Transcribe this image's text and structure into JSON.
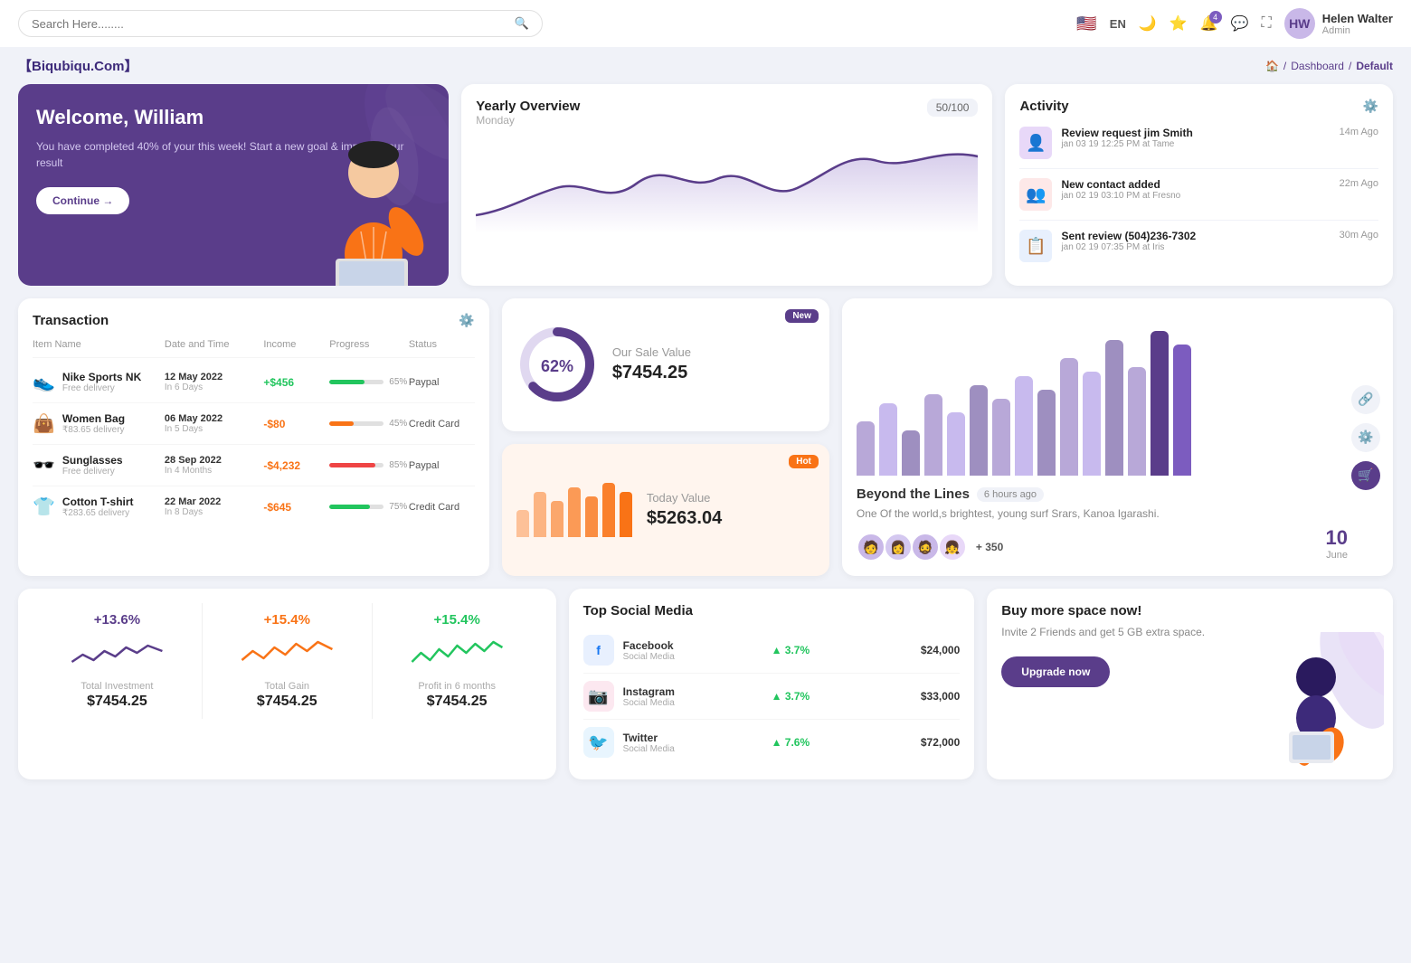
{
  "app": {
    "brand": "【Biqubiqu.Com】",
    "breadcrumb": [
      "Home",
      "Dashboard",
      "Default"
    ]
  },
  "topnav": {
    "search_placeholder": "Search Here........",
    "lang": "EN",
    "notification_count": "4",
    "user": {
      "name": "Helen Walter",
      "role": "Admin",
      "initials": "HW"
    }
  },
  "welcome": {
    "title": "Welcome, William",
    "desc": "You have completed 40% of your this week! Start a new goal & improve your result",
    "button": "Continue →"
  },
  "yearly": {
    "title": "Yearly Overview",
    "sub": "Monday",
    "badge": "50/100"
  },
  "activity": {
    "title": "Activity",
    "items": [
      {
        "title": "Review request jim Smith",
        "time": "jan 03 19 12:25 PM at Tame",
        "ago": "14m Ago",
        "emoji": "🖼️"
      },
      {
        "title": "New contact added",
        "time": "jan 02 19 03:10 PM at Fresno",
        "ago": "22m Ago",
        "emoji": "🖼️"
      },
      {
        "title": "Sent review (504)236-7302",
        "time": "jan 02 19 07:35 PM at Iris",
        "ago": "30m Ago",
        "emoji": "🖼️"
      }
    ]
  },
  "transaction": {
    "title": "Transaction",
    "columns": [
      "Item Name",
      "Date and Time",
      "Income",
      "Progress",
      "Status"
    ],
    "rows": [
      {
        "name": "Nike Sports NK",
        "sub": "Free delivery",
        "date": "12 May 2022",
        "datesub": "In 6 Days",
        "income": "+$456",
        "positive": true,
        "progress": 65,
        "progress_color": "#22c55e",
        "status": "Paypal",
        "emoji": "👟"
      },
      {
        "name": "Women Bag",
        "sub": "₹83.65 delivery",
        "date": "06 May 2022",
        "datesub": "In 5 Days",
        "income": "-$80",
        "positive": false,
        "progress": 45,
        "progress_color": "#f97316",
        "status": "Credit Card",
        "emoji": "👜"
      },
      {
        "name": "Sunglasses",
        "sub": "Free delivery",
        "date": "28 Sep 2022",
        "datesub": "In 4 Months",
        "income": "-$4,232",
        "positive": false,
        "progress": 85,
        "progress_color": "#ef4444",
        "status": "Paypal",
        "emoji": "🕶️"
      },
      {
        "name": "Cotton T-shirt",
        "sub": "₹283.65 delivery",
        "date": "22 Mar 2022",
        "datesub": "In 8 Days",
        "income": "-$645",
        "positive": false,
        "progress": 75,
        "progress_color": "#22c55e",
        "status": "Credit Card",
        "emoji": "👕"
      }
    ]
  },
  "sale_value": {
    "percent": "62%",
    "label": "Our Sale Value",
    "amount": "$7454.25",
    "badge": "New"
  },
  "today_value": {
    "label": "Today Value",
    "amount": "$5263.04",
    "badge": "Hot",
    "bars": [
      30,
      50,
      40,
      70,
      55,
      80,
      60
    ]
  },
  "beyond": {
    "title": "Beyond the Lines",
    "time": "6 hours ago",
    "desc": "One Of the world,s brightest, young surf Srars, Kanoa Igarashi.",
    "plus_count": "+ 350",
    "date": "10",
    "month": "June",
    "bars": [
      60,
      80,
      50,
      90,
      70,
      100,
      85,
      110,
      95,
      130,
      115,
      150,
      120,
      160,
      145
    ],
    "bar_colors": [
      "#9e8fc0",
      "#b8a8d8",
      "#9e8fc0",
      "#b8a8d8",
      "#c8baee",
      "#9e8fc0",
      "#b8a8d8",
      "#c8baee",
      "#9e8fc0",
      "#b8a8d8",
      "#c8baee",
      "#9e8fc0",
      "#b8a8d8",
      "#5a3d8a",
      "#7c5cbf"
    ]
  },
  "stats": [
    {
      "pct": "+13.6%",
      "pct_color": "#5a3d8a",
      "label": "Total Investment",
      "value": "$7454.25",
      "wave_color": "#5a3d8a"
    },
    {
      "pct": "+15.4%",
      "pct_color": "#f97316",
      "label": "Total Gain",
      "value": "$7454.25",
      "wave_color": "#f97316"
    },
    {
      "pct": "+15.4%",
      "pct_color": "#22c55e",
      "label": "Profit in 6 months",
      "value": "$7454.25",
      "wave_color": "#22c55e"
    }
  ],
  "social": {
    "title": "Top Social Media",
    "items": [
      {
        "name": "Facebook",
        "type": "Social Media",
        "pct": "3.7%",
        "value": "$24,000",
        "color": "#1877f2",
        "emoji": "f"
      },
      {
        "name": "Instagram",
        "type": "Social Media",
        "pct": "3.7%",
        "value": "$33,000",
        "color": "#e1306c",
        "emoji": "📷"
      },
      {
        "name": "Twitter",
        "type": "Social Media",
        "pct": "7.6%",
        "value": "$72,000",
        "color": "#1da1f2",
        "emoji": "🐦"
      }
    ]
  },
  "space": {
    "title": "Buy more space now!",
    "desc": "Invite 2 Friends and get 5 GB extra space.",
    "button": "Upgrade now"
  }
}
